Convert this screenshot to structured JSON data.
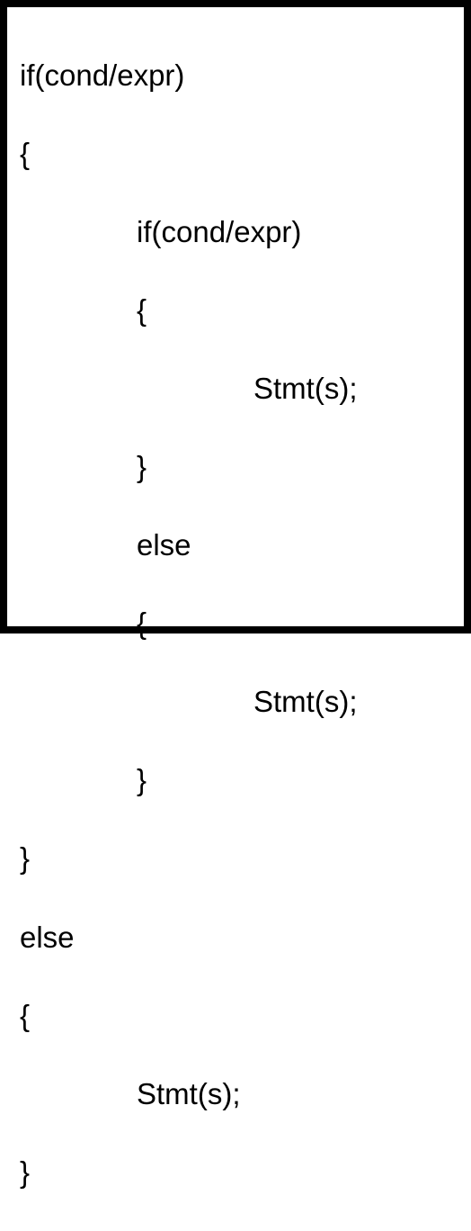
{
  "code": {
    "line1": "if(cond/expr)",
    "line2": "{",
    "line3": "if(cond/expr)",
    "line4": "{",
    "line5": "Stmt(s);",
    "line6": "}",
    "line7": "else",
    "line8": "{",
    "line9": "Stmt(s);",
    "line10": "}",
    "line11": "}",
    "line12": "else",
    "line13": "{",
    "line14": "Stmt(s);",
    "line15": "}"
  }
}
